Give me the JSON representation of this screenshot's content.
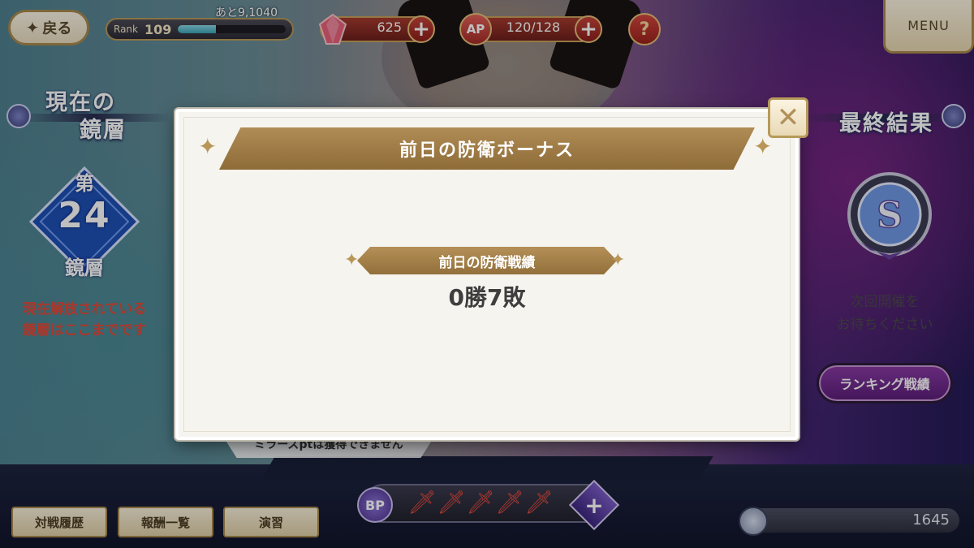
{
  "top_bar": {
    "back_label": "戻る",
    "rank_label": "Rank",
    "rank_value": "109",
    "rank_next": "あと9,1040",
    "rank_progress": 0.35,
    "magia_stone": "625",
    "ap_label": "AP",
    "ap_value": "120/128",
    "help_label": "?",
    "menu_label": "MENU"
  },
  "left_panel": {
    "title_line1": "現在の",
    "title_line2": "鏡層",
    "floor_prefix": "第",
    "floor_number": "24",
    "floor_suffix": "鏡層",
    "note_line1": "現在解放されている",
    "note_line2": "鏡層はここまでです"
  },
  "right_panel": {
    "title": "最終結果",
    "emblem_letter": "S",
    "note_line1": "次回開催を",
    "note_line2": "お待ちください",
    "ranking_button": "ランキング戦績"
  },
  "bottom_bar": {
    "mirror_note": "ミラーズptは獲得できません",
    "tabs": [
      "対戦履歴",
      "報酬一覧",
      "演習"
    ],
    "bp_label": "BP",
    "bp_count": 5,
    "points": "1645"
  },
  "modal": {
    "title": "前日の防衛ボーナス",
    "section_title": "前日の防衛戦績",
    "record": "0勝7敗",
    "close_label": "✕"
  },
  "colors": {
    "gold": "#a88a4e",
    "banner": "#9d7a44",
    "alert_red": "#e24a3a",
    "purple": "#6a2a8c"
  }
}
